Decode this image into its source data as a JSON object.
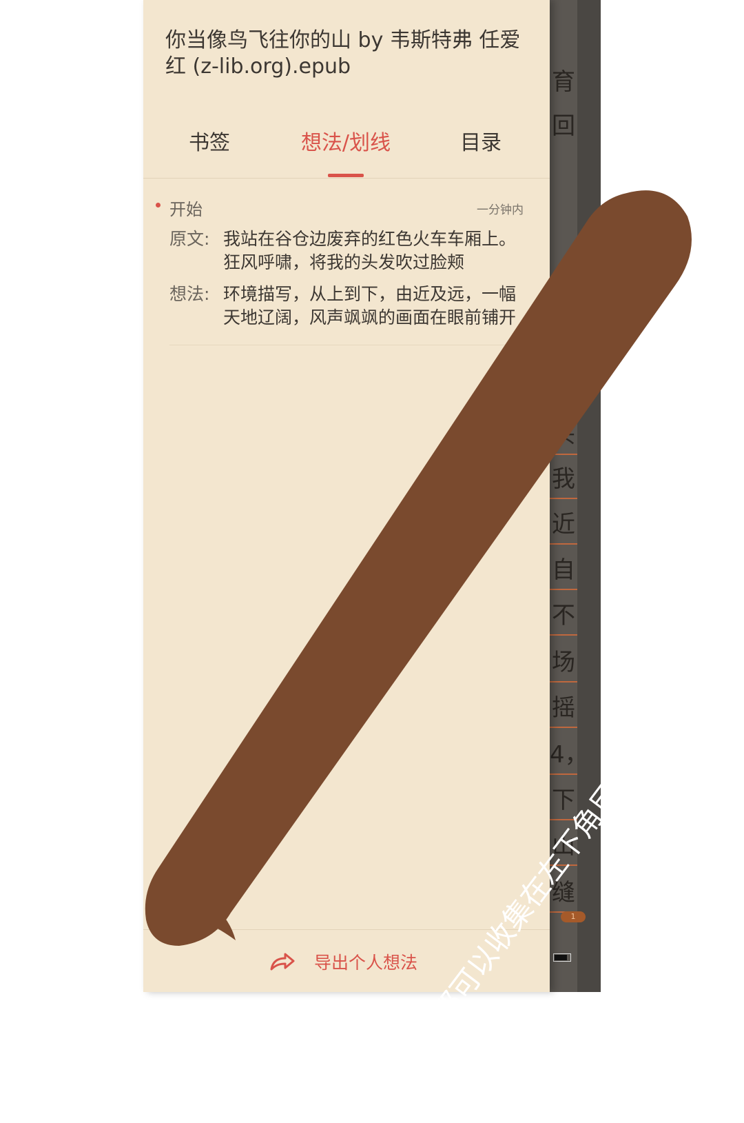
{
  "drawer": {
    "book_title": "你当像鸟飞往你的山 by 韦斯特弗 任爱红 (z-lib.org).epub",
    "tabs": [
      {
        "label": "书签",
        "active": false
      },
      {
        "label": "想法/划线",
        "active": true
      },
      {
        "label": "目录",
        "active": false
      }
    ],
    "note": {
      "chapter": "开始",
      "time": "一分钟内",
      "original_label": "原文:",
      "original_text": "我站在谷仓边废弃的红色火车车厢上。狂风呼啸，将我的头发吹过脸颊",
      "thought_label": "想法:",
      "thought_text": "环境描写，从上到下，由近及远，一幅天地辽阔，风声飒飒的画面在眼前铺开"
    },
    "export_label": "导出个人想法",
    "export_icon": "share-arrow-icon"
  },
  "reader": {
    "visible_chars": [
      "育",
      "回",
      "头",
      "我",
      "近",
      "自",
      "不",
      "场",
      "摇",
      "4，",
      "下",
      "山",
      "缝"
    ],
    "page_indicator": "1"
  },
  "banner": {
    "text": "所有想法都可以收集在左下角目录-想法/划线里，可以导出",
    "color": "#7a4a2e"
  },
  "colors": {
    "accent": "#d9534a",
    "drawer_bg": "#f3e6cf",
    "reader_bg": "#5b5752"
  }
}
